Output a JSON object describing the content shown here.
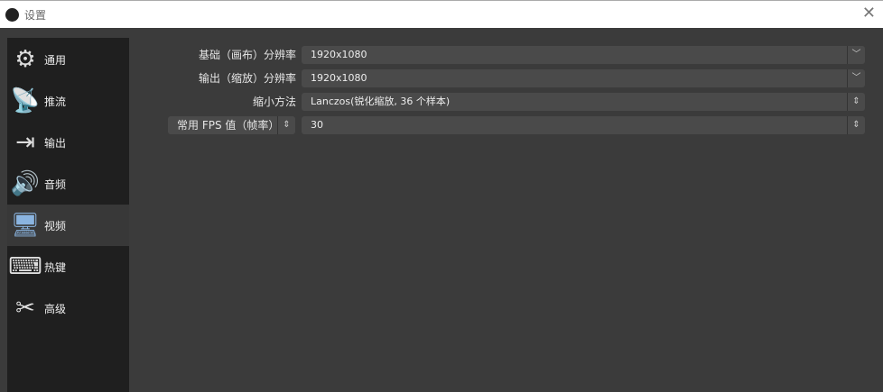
{
  "window": {
    "title": "设置",
    "close": "✕"
  },
  "sidebar": {
    "items": [
      {
        "label": "通用",
        "icon": "⚙"
      },
      {
        "label": "推流",
        "icon": "📡"
      },
      {
        "label": "输出",
        "icon": "⇥"
      },
      {
        "label": "音频",
        "icon": "🔊"
      },
      {
        "label": "视频",
        "icon": "🖥"
      },
      {
        "label": "热键",
        "icon": "⌨"
      },
      {
        "label": "高级",
        "icon": "✂"
      }
    ],
    "selected": "视频"
  },
  "video": {
    "base_label": "基础（画布）分辨率",
    "base_value": "1920x1080",
    "output_label": "输出（缩放）分辨率",
    "output_value": "1920x1080",
    "filter_label": "缩小方法",
    "filter_value": "Lanczos(锐化缩放, 36 个样本)",
    "fps_label": "常用 FPS 值（帧率）",
    "fps_value": "30"
  }
}
